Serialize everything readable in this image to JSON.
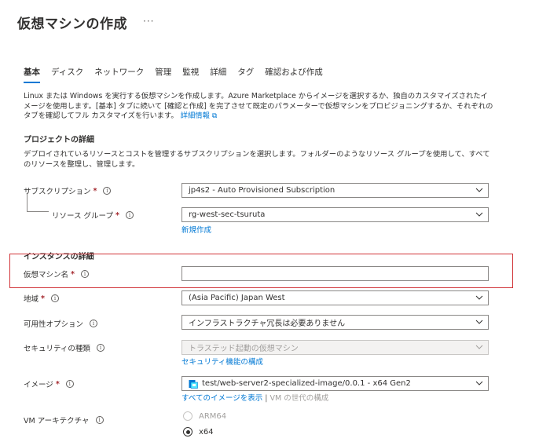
{
  "page": {
    "title": "仮想マシンの作成",
    "more": "···"
  },
  "tabs": [
    {
      "label": "基本",
      "active": true
    },
    {
      "label": "ディスク"
    },
    {
      "label": "ネットワーク"
    },
    {
      "label": "管理"
    },
    {
      "label": "監視"
    },
    {
      "label": "詳細"
    },
    {
      "label": "タグ"
    },
    {
      "label": "確認および作成"
    }
  ],
  "intro": {
    "text": "Linux または Windows を実行する仮想マシンを作成します。Azure Marketplace からイメージを選択するか、独自のカスタマイズされたイメージを使用します。[基本] タブに続いて [確認と作成] を完了させて既定のパラメーターで仮想マシンをプロビジョニングするか、それぞれのタブを確認してフル カスタマイズを行います。",
    "link": "詳細情報",
    "link_icon": "external-link-icon"
  },
  "project": {
    "heading": "プロジェクトの詳細",
    "description": "デプロイされているリソースとコストを管理するサブスクリプションを選択します。フォルダーのようなリソース グループを使用して、すべてのリソースを整理し、管理します。",
    "subscription": {
      "label": "サブスクリプション",
      "value": "jp4s2 - Auto Provisioned Subscription"
    },
    "resource_group": {
      "label": "リソース グループ",
      "value": "rg-west-sec-tsuruta",
      "create_link": "新規作成"
    }
  },
  "instance": {
    "heading": "インスタンスの詳細",
    "vm_name": {
      "label": "仮想マシン名",
      "value": ""
    },
    "region": {
      "label": "地域",
      "value": "(Asia Pacific) Japan West"
    },
    "availability": {
      "label": "可用性オプション",
      "value": "インフラストラクチャ冗長は必要ありません"
    },
    "security_type": {
      "label": "セキュリティの種類",
      "value": "トラステッド起動の仮想マシン",
      "link": "セキュリティ機能の構成"
    },
    "image": {
      "label": "イメージ",
      "value": "test/web-server2-specialized-image/0.0.1 - x64 Gen2",
      "link_all": "すべてのイメージを表示",
      "separator": "|",
      "link_gen": "VM の世代の構成"
    },
    "architecture": {
      "label": "VM アーキテクチャ",
      "options": [
        {
          "label": "ARM64",
          "disabled": true,
          "checked": false
        },
        {
          "label": "x64",
          "disabled": false,
          "checked": true
        }
      ]
    }
  },
  "colors": {
    "accent": "#0078d4",
    "required": "#a4262c",
    "highlight": "#d13438"
  }
}
